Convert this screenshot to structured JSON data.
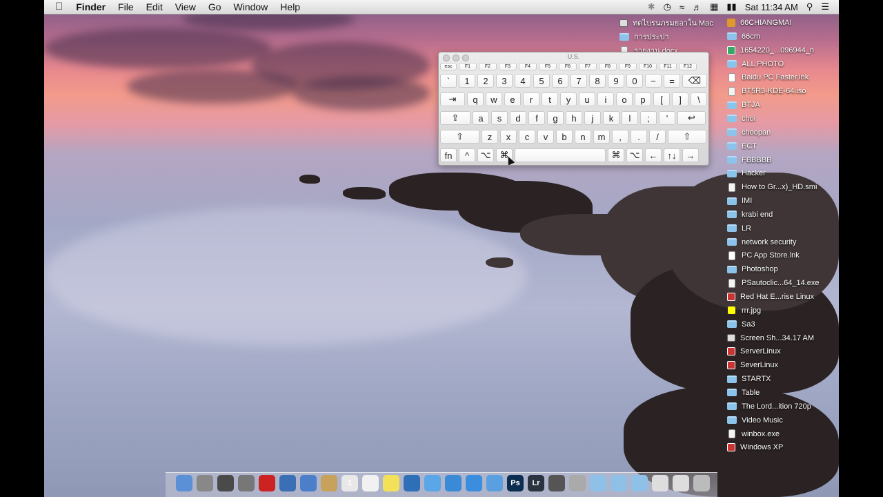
{
  "menubar": {
    "apple": "",
    "items": [
      "Finder",
      "File",
      "Edit",
      "View",
      "Go",
      "Window",
      "Help"
    ],
    "status": {
      "clock": "Sat 11:34 AM"
    }
  },
  "keyboard_viewer": {
    "title": "U.S.",
    "function_row": [
      "esc",
      "F1",
      "F2",
      "F3",
      "F4",
      "F5",
      "F6",
      "F7",
      "F8",
      "F9",
      "F10",
      "F11",
      "F12"
    ],
    "number_row": [
      "`",
      "1",
      "2",
      "3",
      "4",
      "5",
      "6",
      "7",
      "8",
      "9",
      "0",
      "−",
      "=",
      "⌫"
    ],
    "qwerty_row": [
      "⇥",
      "q",
      "w",
      "e",
      "r",
      "t",
      "y",
      "u",
      "i",
      "o",
      "p",
      "[",
      "]",
      "\\"
    ],
    "home_row": [
      "⇪",
      "a",
      "s",
      "d",
      "f",
      "g",
      "h",
      "j",
      "k",
      "l",
      ";",
      "'",
      "↩"
    ],
    "shift_row": [
      "⇧",
      "z",
      "x",
      "c",
      "v",
      "b",
      "n",
      "m",
      ",",
      ".",
      "/",
      "⇧"
    ],
    "bottom_row": [
      "fn",
      "^",
      "⌥",
      "⌘",
      "",
      "⌘",
      "⌥",
      "←",
      "↑↓",
      "→"
    ]
  },
  "desktop_left_column": [
    "ทดไบรนภรมยอาใน Mac",
    "การประปา",
    "รายงาน.docx"
  ],
  "desktop_icons": [
    {
      "name": "66CHIANGMAI",
      "kind": "orange"
    },
    {
      "name": "66cm",
      "kind": "folder"
    },
    {
      "name": "1654220_...096944_n",
      "kind": "grn"
    },
    {
      "name": "ALL PHOTO",
      "kind": "folder"
    },
    {
      "name": "Baidu PC Faster.lnk",
      "kind": "lnk"
    },
    {
      "name": "BT5R3-KDE-64.iso",
      "kind": "file"
    },
    {
      "name": "BTJA",
      "kind": "folder"
    },
    {
      "name": "choi",
      "kind": "folder"
    },
    {
      "name": "choopan",
      "kind": "folder"
    },
    {
      "name": "ECT",
      "kind": "folder"
    },
    {
      "name": "FBBBBB",
      "kind": "folder"
    },
    {
      "name": "Hacker",
      "kind": "folder"
    },
    {
      "name": "How to Gr...x)_HD.smi",
      "kind": "file"
    },
    {
      "name": "IMI",
      "kind": "folder"
    },
    {
      "name": "krabi end",
      "kind": "folder"
    },
    {
      "name": "LR",
      "kind": "folder"
    },
    {
      "name": "network security",
      "kind": "folder"
    },
    {
      "name": "PC App Store.lnk",
      "kind": "lnk"
    },
    {
      "name": "Photoshop",
      "kind": "folder"
    },
    {
      "name": "PSautoclic...64_14.exe",
      "kind": "file"
    },
    {
      "name": "Red Hat E...rise Linux",
      "kind": "red"
    },
    {
      "name": "rrr.jpg",
      "kind": "yel"
    },
    {
      "name": "Sa3",
      "kind": "folder"
    },
    {
      "name": "Screen Sh...34.17 AM",
      "kind": "scr"
    },
    {
      "name": "ServerLinux",
      "kind": "red"
    },
    {
      "name": "SeverLinux",
      "kind": "red"
    },
    {
      "name": "STARTX",
      "kind": "folder"
    },
    {
      "name": "Table",
      "kind": "folder"
    },
    {
      "name": "The Lord...ition 720p",
      "kind": "folder"
    },
    {
      "name": "Video Music",
      "kind": "folder"
    },
    {
      "name": "winbox.exe",
      "kind": "file"
    },
    {
      "name": "Windows XP",
      "kind": "red"
    }
  ],
  "dock": [
    {
      "icon": "finder-icon",
      "color": "#5b8fd6",
      "label": ""
    },
    {
      "icon": "launchpad-icon",
      "color": "#888",
      "label": ""
    },
    {
      "icon": "mission-control-icon",
      "color": "#4a4a4a",
      "label": ""
    },
    {
      "icon": "system-preferences-icon",
      "color": "#777",
      "label": ""
    },
    {
      "icon": "parallels-icon",
      "color": "#c22",
      "label": ""
    },
    {
      "icon": "virtualbox-icon",
      "color": "#3b6fb5",
      "label": ""
    },
    {
      "icon": "preview-icon",
      "color": "#4c7fc9",
      "label": ""
    },
    {
      "icon": "contacts-icon",
      "color": "#c8a25d",
      "label": ""
    },
    {
      "icon": "calendar-icon",
      "color": "#e8e8e8",
      "label": "1"
    },
    {
      "icon": "textedit-icon",
      "color": "#f1f1f1",
      "label": ""
    },
    {
      "icon": "stickies-icon",
      "color": "#f3e15a",
      "label": ""
    },
    {
      "icon": "quicktime-icon",
      "color": "#2f6fb8",
      "label": ""
    },
    {
      "icon": "messages-icon",
      "color": "#5aa6e8",
      "label": ""
    },
    {
      "icon": "itunes-icon",
      "color": "#3a8ad8",
      "label": ""
    },
    {
      "icon": "app-store-icon",
      "color": "#3b8de0",
      "label": ""
    },
    {
      "icon": "safari-icon",
      "color": "#5aa0e0",
      "label": ""
    },
    {
      "icon": "photoshop-icon",
      "color": "#0b2d4f",
      "label": "Ps"
    },
    {
      "icon": "lightroom-icon",
      "color": "#2a3440",
      "label": "Lr"
    },
    {
      "icon": "facetime-icon",
      "color": "#555",
      "label": ""
    },
    {
      "icon": "utility-icon",
      "color": "#aaa",
      "label": ""
    },
    {
      "icon": "downloads-stack-icon",
      "color": "#8fc0e8",
      "label": ""
    },
    {
      "icon": "applications-stack-icon",
      "color": "#8fc0e8",
      "label": ""
    },
    {
      "icon": "documents-stack-icon",
      "color": "#8fc0e8",
      "label": ""
    },
    {
      "icon": "keyboard-icon",
      "color": "#ddd",
      "label": ""
    },
    {
      "icon": "screen-icon",
      "color": "#ddd",
      "label": ""
    },
    {
      "icon": "trash-icon",
      "color": "#bbb",
      "label": ""
    }
  ]
}
